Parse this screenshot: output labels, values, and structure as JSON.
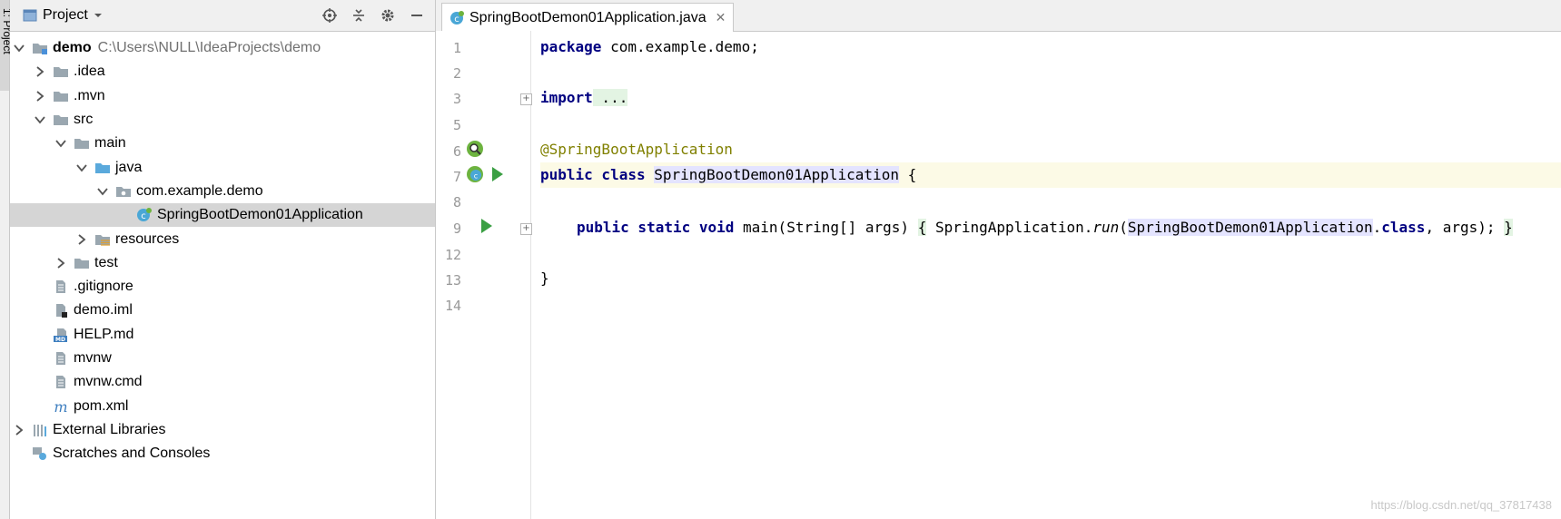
{
  "side_strip": {
    "label": "1: Project"
  },
  "project_panel": {
    "title": "Project",
    "tree": [
      {
        "label": "demo",
        "path": "C:\\Users\\NULL\\IdeaProjects\\demo",
        "bold": true,
        "depth": 0,
        "arrow": "down",
        "icon": "module-folder-icon"
      },
      {
        "label": ".idea",
        "depth": 1,
        "arrow": "right",
        "icon": "folder-icon"
      },
      {
        "label": ".mvn",
        "depth": 1,
        "arrow": "right",
        "icon": "folder-icon"
      },
      {
        "label": "src",
        "depth": 1,
        "arrow": "down",
        "icon": "folder-icon"
      },
      {
        "label": "main",
        "depth": 2,
        "arrow": "down",
        "icon": "folder-icon"
      },
      {
        "label": "java",
        "depth": 3,
        "arrow": "down",
        "icon": "source-folder-icon"
      },
      {
        "label": "com.example.demo",
        "depth": 4,
        "arrow": "down",
        "icon": "package-icon"
      },
      {
        "label": "SpringBootDemon01Application",
        "depth": 5,
        "arrow": "none",
        "icon": "spring-class-icon",
        "selected": true
      },
      {
        "label": "resources",
        "depth": 3,
        "arrow": "right",
        "icon": "resources-folder-icon"
      },
      {
        "label": "test",
        "depth": 2,
        "arrow": "right",
        "icon": "folder-icon"
      },
      {
        "label": ".gitignore",
        "depth": 1,
        "arrow": "none",
        "icon": "file-icon"
      },
      {
        "label": "demo.iml",
        "depth": 1,
        "arrow": "none",
        "icon": "iml-file-icon"
      },
      {
        "label": "HELP.md",
        "depth": 1,
        "arrow": "none",
        "icon": "markdown-file-icon"
      },
      {
        "label": "mvnw",
        "depth": 1,
        "arrow": "none",
        "icon": "file-icon"
      },
      {
        "label": "mvnw.cmd",
        "depth": 1,
        "arrow": "none",
        "icon": "file-icon"
      },
      {
        "label": "pom.xml",
        "depth": 1,
        "arrow": "none",
        "icon": "maven-file-icon"
      },
      {
        "label": "External Libraries",
        "depth": 0,
        "arrow": "right",
        "icon": "libraries-icon"
      },
      {
        "label": "Scratches and Consoles",
        "depth": 0,
        "arrow": "none",
        "icon": "scratches-icon"
      }
    ]
  },
  "editor": {
    "tab_label": "SpringBootDemon01Application.java",
    "line_numbers": [
      "1",
      "2",
      "3",
      "5",
      "6",
      "7",
      "8",
      "9",
      "12",
      "13",
      "14"
    ],
    "code": {
      "l1_kw": "package",
      "l1_rest": " com.example.demo;",
      "l3_kw": "import",
      "l3_rest": " ...",
      "l6_ann": "@SpringBootApplication",
      "l7_kw": "public class",
      "l7_class": "SpringBootDemon01Application",
      "l7_rest": " {",
      "l9_kw": "public static void",
      "l9_a": " main(String[] args) ",
      "l9_b": "{",
      "l9_c": " SpringApplication.",
      "l9_run": "run",
      "l9_d": "(",
      "l9_class": "SpringBootDemon01Application",
      "l9_e": ".",
      "l9_kw2": "class",
      "l9_f": ", args); ",
      "l9_g": "}",
      "l13": "}"
    }
  },
  "watermark": "https://blog.csdn.net/qq_37817438",
  "colors": {
    "keyword": "#000080",
    "annotation": "#808000",
    "selection": "#d5d5d5",
    "caret_line": "#fcfae6",
    "run_green": "#3a9f43"
  }
}
